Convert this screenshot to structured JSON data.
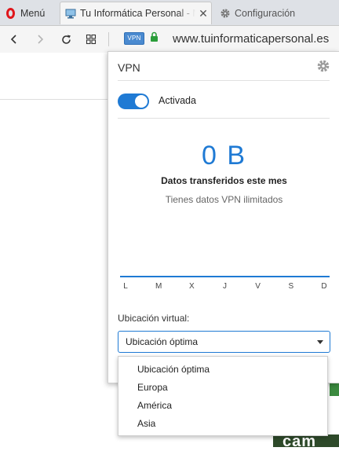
{
  "tabs": {
    "menu_label": "Menú",
    "active_title": "Tu Informática Personal - N",
    "close_glyph": "✕",
    "config_title": "Configuración"
  },
  "address_bar": {
    "vpn_badge": "VPN",
    "url": "www.tuinformaticapersonal.es"
  },
  "vpn_popup": {
    "title": "VPN",
    "toggle": {
      "label": "Activada",
      "state": "on"
    },
    "data_amount": "0 B",
    "data_title": "Datos transferidos este mes",
    "data_subtitle": "Tienes datos VPN ilimitados",
    "weekdays": [
      "L",
      "M",
      "X",
      "J",
      "V",
      "S",
      "D"
    ],
    "location": {
      "label": "Ubicación virtual:",
      "selected": "Ubicación óptima",
      "options": [
        "Ubicación óptima",
        "Europa",
        "América",
        "Asia"
      ]
    }
  },
  "background_page": {
    "fragment_text": "cam"
  },
  "colors": {
    "accent": "#1f7ad4",
    "opera_red": "#e0161b",
    "secure_lock": "#2a9d3a"
  },
  "icons": {
    "opera": "opera-logo-icon",
    "tab_favicon": "monitor-icon",
    "config": "gear-icon",
    "back": "back-arrow-icon",
    "forward": "forward-arrow-icon",
    "reload": "reload-icon",
    "speed_dial": "grid-icon",
    "lock": "lock-icon",
    "popup_settings": "gear-icon",
    "dropdown": "caret-down-icon"
  }
}
